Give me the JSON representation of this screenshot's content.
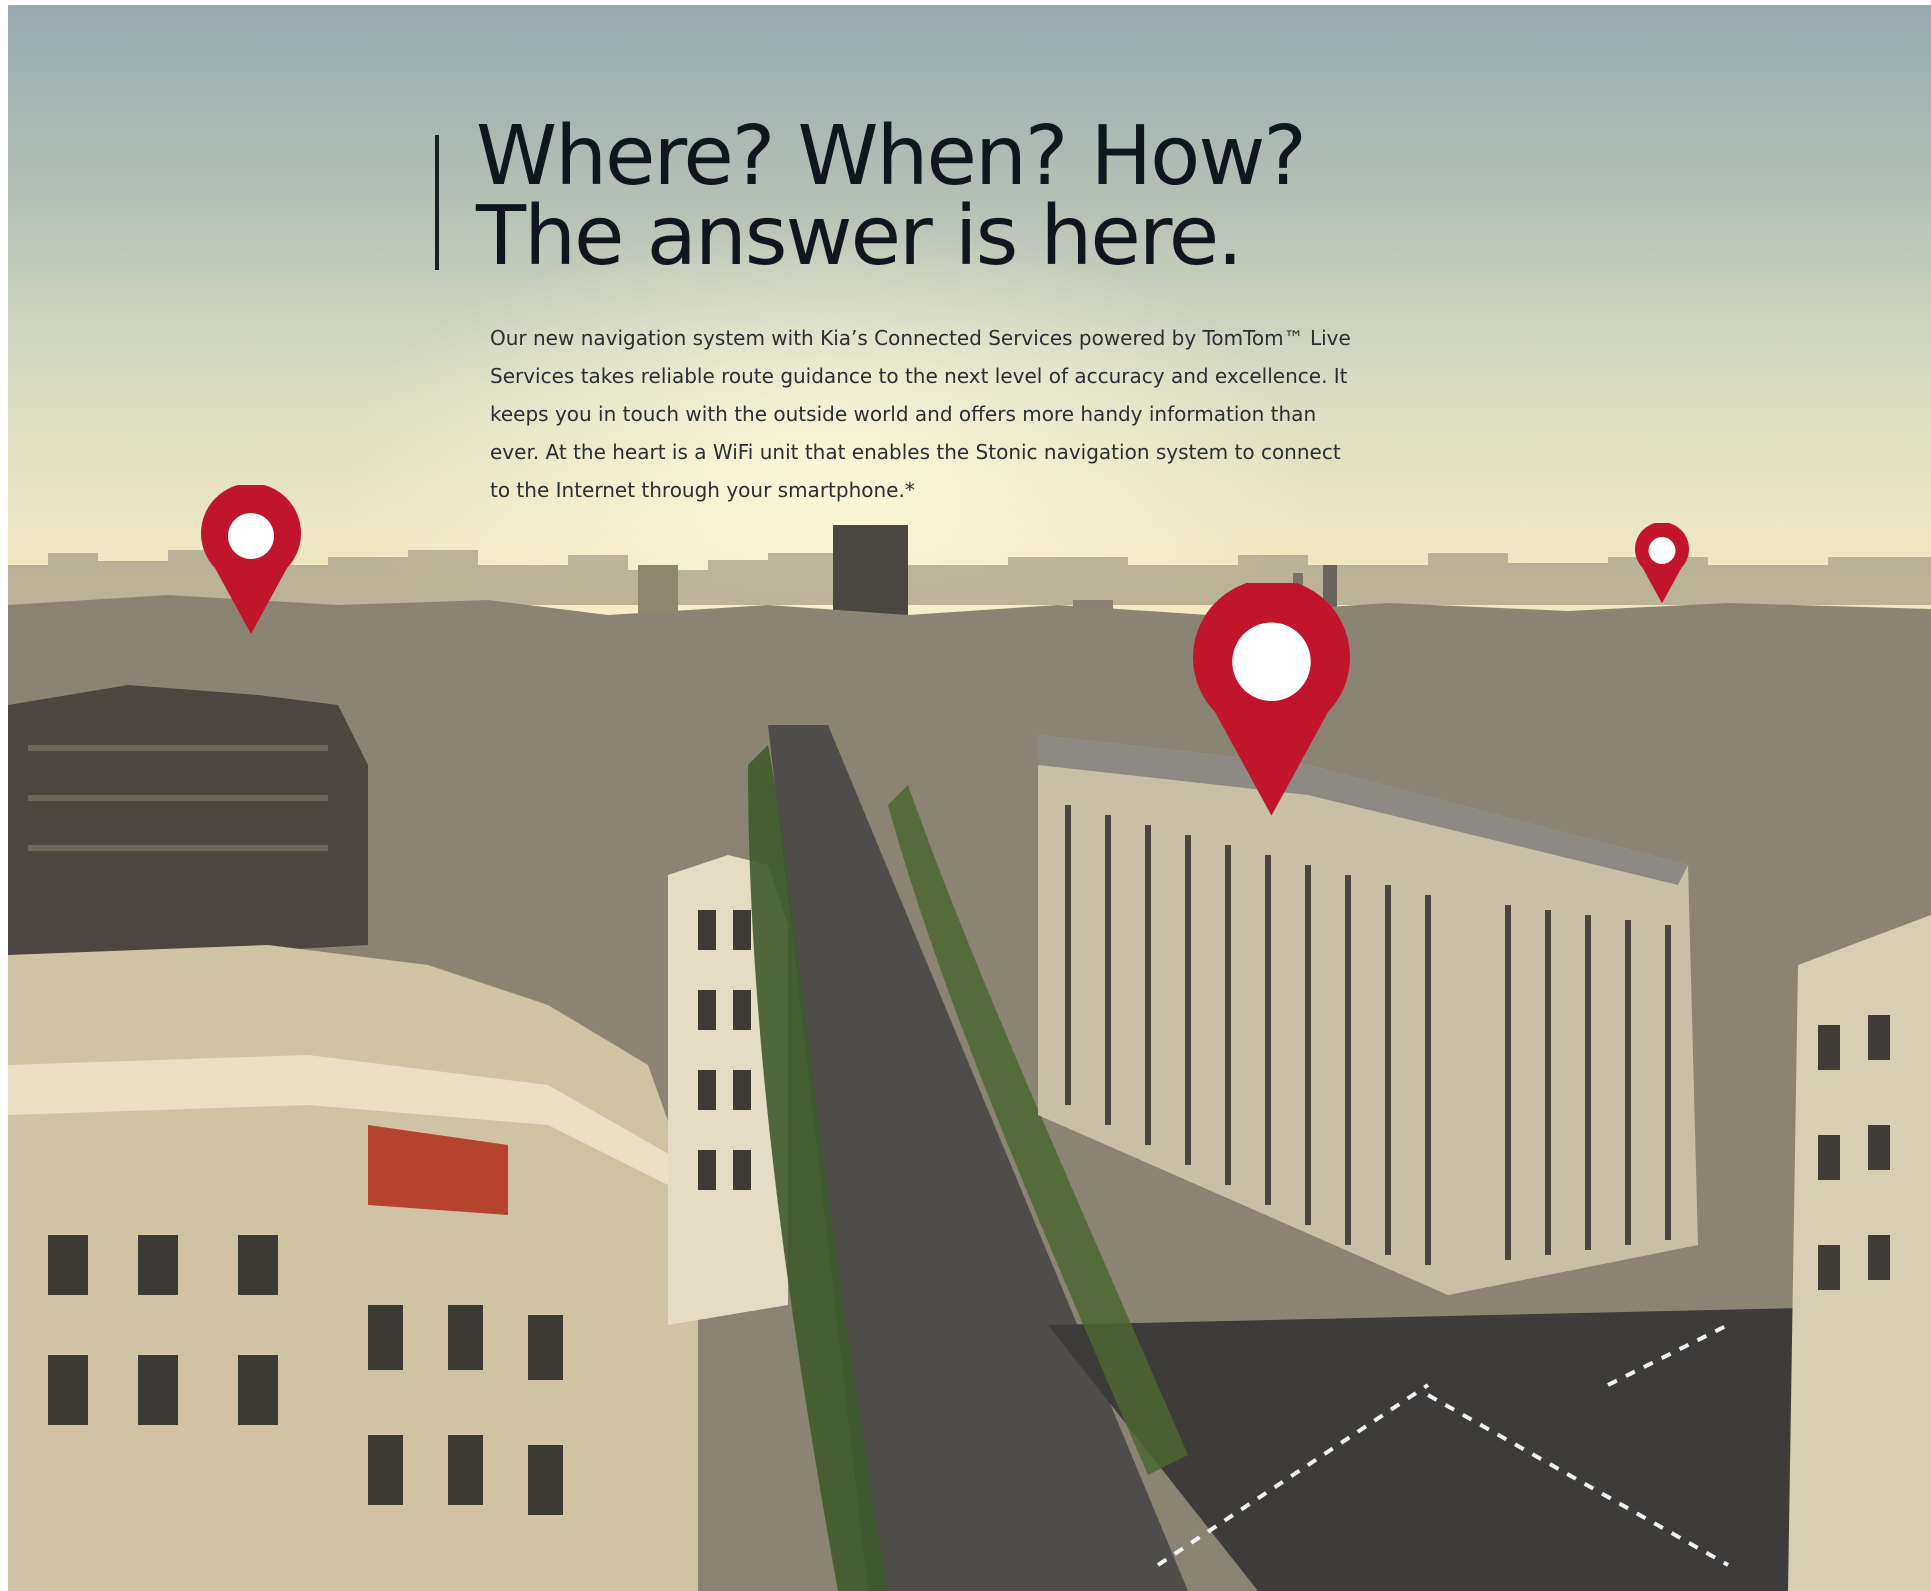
{
  "headline": {
    "line1": "Where? When? How?",
    "line2": "The answer is here."
  },
  "body_text": "Our new navigation system with Kia’s Connected Services powered by TomTom™ Live Services takes reliable route guidance to the next level of accuracy and excellence. It keeps you in touch with the outside world and offers more handy information than ever. At the heart is a WiFi unit that enables the Stonic navigation system to connect to the Internet through your smartphone.*",
  "colors": {
    "pin": "#c0152b",
    "headline": "#0f171e",
    "body": "#2b2f33"
  },
  "icons": [
    "location-pin-icon"
  ]
}
